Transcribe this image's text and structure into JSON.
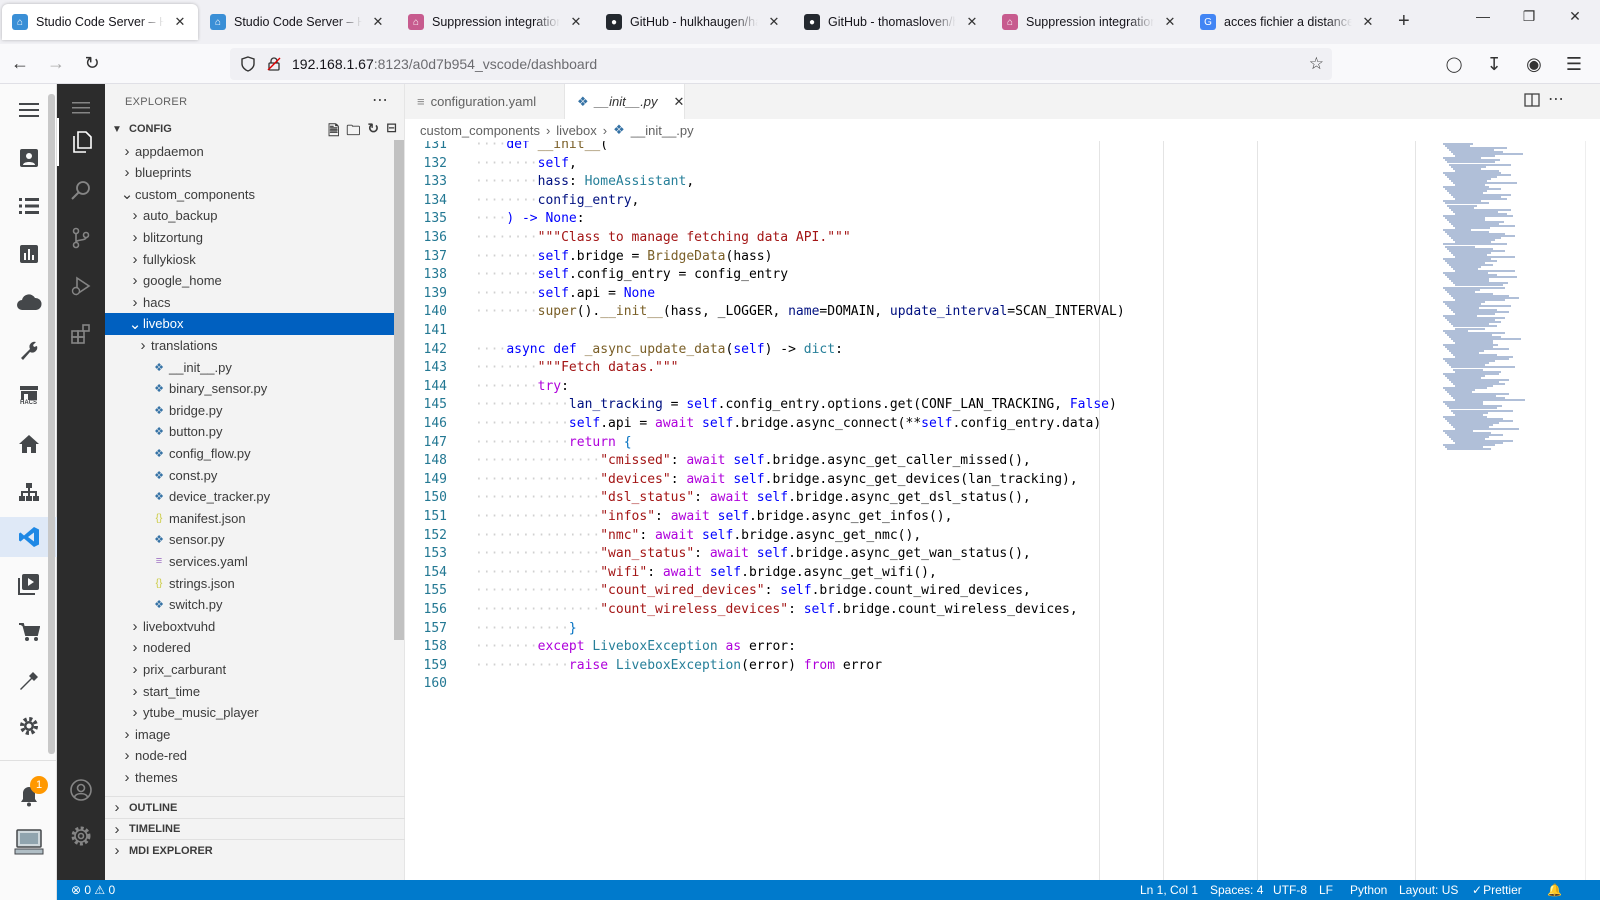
{
  "browser": {
    "tabs": [
      {
        "title": "Studio Code Server – Hom",
        "icon": "vscode-icon",
        "color": "#3a8fd6",
        "active": true
      },
      {
        "title": "Studio Code Server – Hom",
        "icon": "vscode-icon",
        "color": "#3a8fd6",
        "active": false
      },
      {
        "title": "Suppression integration - ",
        "icon": "home-assistant-icon",
        "color": "#c75b8e",
        "active": false
      },
      {
        "title": "GitHub - hulkhaugen/has",
        "icon": "github-icon",
        "color": "#24292f",
        "active": false
      },
      {
        "title": "GitHub - thomasloven/ha",
        "icon": "github-icon",
        "color": "#24292f",
        "active": false
      },
      {
        "title": "Suppression integration - ",
        "icon": "home-assistant-icon",
        "color": "#c75b8e",
        "active": false
      },
      {
        "title": "acces fichier a distance ho",
        "icon": "google-icon",
        "color": "#4285f4",
        "active": false
      }
    ],
    "new_tab": "+",
    "url_host": "192.168.1.67",
    "url_rest": ":8123/a0d7b954_vscode/dashboard"
  },
  "explorer": {
    "title": "EXPLORER",
    "section": "CONFIG",
    "tree": [
      {
        "label": "appdaemon",
        "depth": 0,
        "type": "folder",
        "open": false
      },
      {
        "label": "blueprints",
        "depth": 0,
        "type": "folder",
        "open": false
      },
      {
        "label": "custom_components",
        "depth": 0,
        "type": "folder",
        "open": true
      },
      {
        "label": "auto_backup",
        "depth": 1,
        "type": "folder",
        "open": false
      },
      {
        "label": "blitzortung",
        "depth": 1,
        "type": "folder",
        "open": false
      },
      {
        "label": "fullykiosk",
        "depth": 1,
        "type": "folder",
        "open": false
      },
      {
        "label": "google_home",
        "depth": 1,
        "type": "folder",
        "open": false
      },
      {
        "label": "hacs",
        "depth": 1,
        "type": "folder",
        "open": false
      },
      {
        "label": "livebox",
        "depth": 1,
        "type": "folder",
        "open": true,
        "selected": true
      },
      {
        "label": "translations",
        "depth": 2,
        "type": "folder",
        "open": false
      },
      {
        "label": "__init__.py",
        "depth": 2,
        "type": "py"
      },
      {
        "label": "binary_sensor.py",
        "depth": 2,
        "type": "py"
      },
      {
        "label": "bridge.py",
        "depth": 2,
        "type": "py"
      },
      {
        "label": "button.py",
        "depth": 2,
        "type": "py"
      },
      {
        "label": "config_flow.py",
        "depth": 2,
        "type": "py"
      },
      {
        "label": "const.py",
        "depth": 2,
        "type": "py"
      },
      {
        "label": "device_tracker.py",
        "depth": 2,
        "type": "py"
      },
      {
        "label": "manifest.json",
        "depth": 2,
        "type": "json"
      },
      {
        "label": "sensor.py",
        "depth": 2,
        "type": "py"
      },
      {
        "label": "services.yaml",
        "depth": 2,
        "type": "yaml"
      },
      {
        "label": "strings.json",
        "depth": 2,
        "type": "json"
      },
      {
        "label": "switch.py",
        "depth": 2,
        "type": "py"
      },
      {
        "label": "liveboxtvuhd",
        "depth": 1,
        "type": "folder",
        "open": false
      },
      {
        "label": "nodered",
        "depth": 1,
        "type": "folder",
        "open": false
      },
      {
        "label": "prix_carburant",
        "depth": 1,
        "type": "folder",
        "open": false
      },
      {
        "label": "start_time",
        "depth": 1,
        "type": "folder",
        "open": false
      },
      {
        "label": "ytube_music_player",
        "depth": 1,
        "type": "folder",
        "open": false
      },
      {
        "label": "image",
        "depth": 0,
        "type": "folder",
        "open": false
      },
      {
        "label": "node-red",
        "depth": 0,
        "type": "folder",
        "open": false
      },
      {
        "label": "themes",
        "depth": 0,
        "type": "folder",
        "open": false
      }
    ],
    "bottom_sections": [
      "OUTLINE",
      "TIMELINE",
      "MDI EXPLORER"
    ]
  },
  "editor": {
    "tabs": [
      {
        "label": "configuration.yaml",
        "italic": false,
        "active": false
      },
      {
        "label": "__init__.py",
        "italic": true,
        "active": true
      }
    ],
    "breadcrumb": [
      "custom_components",
      "livebox",
      "__init__.py"
    ],
    "lines": [
      {
        "n": "131",
        "indent": 1,
        "t": [
          [
            "k",
            "def "
          ],
          [
            "f",
            "__init__"
          ],
          [
            "",
            "("
          ]
        ]
      },
      {
        "n": "132",
        "indent": 2,
        "t": [
          [
            "k",
            "self"
          ],
          [
            "",
            ","
          ]
        ]
      },
      {
        "n": "133",
        "indent": 2,
        "t": [
          [
            "n",
            "hass"
          ],
          [
            "",
            ": "
          ],
          [
            "ty",
            "HomeAssistant"
          ],
          [
            "",
            ","
          ]
        ]
      },
      {
        "n": "134",
        "indent": 2,
        "t": [
          [
            "n",
            "config_entry"
          ],
          [
            "",
            ","
          ]
        ]
      },
      {
        "n": "135",
        "indent": 1,
        "t": [
          [
            "k",
            ") -> "
          ],
          [
            "k",
            "None"
          ],
          [
            "",
            ":"
          ]
        ]
      },
      {
        "n": "136",
        "indent": 2,
        "t": [
          [
            "s",
            "\"\"\"Class to manage fetching data API.\"\"\""
          ]
        ]
      },
      {
        "n": "137",
        "indent": 2,
        "t": [
          [
            "k",
            "self"
          ],
          [
            "",
            ".bridge = "
          ],
          [
            "f",
            "BridgeData"
          ],
          [
            "",
            "(hass)"
          ]
        ]
      },
      {
        "n": "138",
        "indent": 2,
        "t": [
          [
            "k",
            "self"
          ],
          [
            "",
            ".config_entry = config_entry"
          ]
        ]
      },
      {
        "n": "139",
        "indent": 2,
        "t": [
          [
            "k",
            "self"
          ],
          [
            "",
            ".api = "
          ],
          [
            "k",
            "None"
          ]
        ]
      },
      {
        "n": "140",
        "indent": 2,
        "t": [
          [
            "f",
            "super"
          ],
          [
            "",
            "()."
          ],
          [
            "f",
            "__init__"
          ],
          [
            "",
            "(hass, _LOGGER, "
          ],
          [
            "n",
            "name"
          ],
          [
            "",
            "=DOMAIN, "
          ],
          [
            "n",
            "update_interval"
          ],
          [
            "",
            "=SCAN_INTERVAL)"
          ]
        ]
      },
      {
        "n": "141",
        "indent": 0,
        "t": []
      },
      {
        "n": "142",
        "indent": 1,
        "t": [
          [
            "k",
            "async def "
          ],
          [
            "f",
            "_async_update_data"
          ],
          [
            "",
            "("
          ],
          [
            "k",
            "self"
          ],
          [
            "",
            ") -> "
          ],
          [
            "ty",
            "dict"
          ],
          [
            "",
            ":"
          ]
        ]
      },
      {
        "n": "143",
        "indent": 2,
        "t": [
          [
            "s",
            "\"\"\"Fetch datas.\"\"\""
          ]
        ]
      },
      {
        "n": "144",
        "indent": 2,
        "t": [
          [
            "c",
            "try"
          ],
          [
            "",
            ":"
          ]
        ]
      },
      {
        "n": "145",
        "indent": 3,
        "t": [
          [
            "n",
            "lan_tracking"
          ],
          [
            "",
            " = "
          ],
          [
            "k",
            "self"
          ],
          [
            "",
            ".config_entry.options.get(CONF_LAN_TRACKING, "
          ],
          [
            "k",
            "False"
          ],
          [
            "",
            ")"
          ]
        ]
      },
      {
        "n": "146",
        "indent": 3,
        "t": [
          [
            "k",
            "self"
          ],
          [
            "",
            ".api = "
          ],
          [
            "c",
            "await "
          ],
          [
            "k",
            "self"
          ],
          [
            "",
            ".bridge.async_connect(**"
          ],
          [
            "k",
            "self"
          ],
          [
            "",
            ".config_entry.data)"
          ]
        ]
      },
      {
        "n": "147",
        "indent": 3,
        "t": [
          [
            "c",
            "return "
          ],
          [
            "sb",
            "{"
          ]
        ]
      },
      {
        "n": "148",
        "indent": 4,
        "t": [
          [
            "s",
            "\"cmissed\""
          ],
          [
            "",
            ": "
          ],
          [
            "c",
            "await "
          ],
          [
            "k",
            "self"
          ],
          [
            "",
            ".bridge.async_get_caller_missed(),"
          ]
        ]
      },
      {
        "n": "149",
        "indent": 4,
        "t": [
          [
            "s",
            "\"devices\""
          ],
          [
            "",
            ": "
          ],
          [
            "c",
            "await "
          ],
          [
            "k",
            "self"
          ],
          [
            "",
            ".bridge.async_get_devices(lan_tracking),"
          ]
        ]
      },
      {
        "n": "150",
        "indent": 4,
        "t": [
          [
            "s",
            "\"dsl_status\""
          ],
          [
            "",
            ": "
          ],
          [
            "c",
            "await "
          ],
          [
            "k",
            "self"
          ],
          [
            "",
            ".bridge.async_get_dsl_status(),"
          ]
        ]
      },
      {
        "n": "151",
        "indent": 4,
        "t": [
          [
            "s",
            "\"infos\""
          ],
          [
            "",
            ": "
          ],
          [
            "c",
            "await "
          ],
          [
            "k",
            "self"
          ],
          [
            "",
            ".bridge.async_get_infos(),"
          ]
        ]
      },
      {
        "n": "152",
        "indent": 4,
        "t": [
          [
            "s",
            "\"nmc\""
          ],
          [
            "",
            ": "
          ],
          [
            "c",
            "await "
          ],
          [
            "k",
            "self"
          ],
          [
            "",
            ".bridge.async_get_nmc(),"
          ]
        ]
      },
      {
        "n": "153",
        "indent": 4,
        "t": [
          [
            "s",
            "\"wan_status\""
          ],
          [
            "",
            ": "
          ],
          [
            "c",
            "await "
          ],
          [
            "k",
            "self"
          ],
          [
            "",
            ".bridge.async_get_wan_status(),"
          ]
        ]
      },
      {
        "n": "154",
        "indent": 4,
        "t": [
          [
            "s",
            "\"wifi\""
          ],
          [
            "",
            ": "
          ],
          [
            "c",
            "await "
          ],
          [
            "k",
            "self"
          ],
          [
            "",
            ".bridge.async_get_wifi(),"
          ]
        ]
      },
      {
        "n": "155",
        "indent": 4,
        "t": [
          [
            "s",
            "\"count_wired_devices\""
          ],
          [
            "",
            ": "
          ],
          [
            "k",
            "self"
          ],
          [
            "",
            ".bridge.count_wired_devices,"
          ]
        ]
      },
      {
        "n": "156",
        "indent": 4,
        "t": [
          [
            "s",
            "\"count_wireless_devices\""
          ],
          [
            "",
            ": "
          ],
          [
            "k",
            "self"
          ],
          [
            "",
            ".bridge.count_wireless_devices,"
          ]
        ]
      },
      {
        "n": "157",
        "indent": 3,
        "t": [
          [
            "sb",
            "}"
          ]
        ]
      },
      {
        "n": "158",
        "indent": 2,
        "t": [
          [
            "c",
            "except "
          ],
          [
            "ty",
            "LiveboxException"
          ],
          [
            "",
            " "
          ],
          [
            "c",
            "as "
          ],
          [
            "",
            "error:"
          ]
        ]
      },
      {
        "n": "159",
        "indent": 3,
        "t": [
          [
            "c",
            "raise "
          ],
          [
            "ty",
            "LiveboxException"
          ],
          [
            "",
            "(error) "
          ],
          [
            "c",
            "from "
          ],
          [
            "",
            "error"
          ]
        ]
      },
      {
        "n": "160",
        "indent": 0,
        "t": []
      }
    ]
  },
  "status": {
    "problems": "⊗ 0 ⚠ 0",
    "position": "Ln 1, Col 1",
    "spaces": "Spaces: 4",
    "encoding": "UTF-8",
    "eol": "LF",
    "language": "Python",
    "layout": "Layout: US",
    "prettier": "Prettier"
  },
  "ha": {
    "notification_count": "1",
    "hacs_label": "HACS"
  }
}
